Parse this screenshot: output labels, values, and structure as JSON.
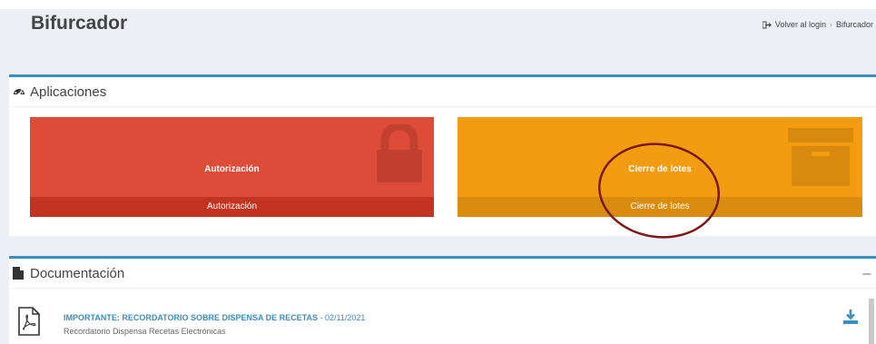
{
  "header": {
    "title": "Bifurcador",
    "breadcrumb": {
      "login_link": "Volver al login",
      "separator": "›",
      "current": "Bifurcador"
    }
  },
  "applications": {
    "title": "Aplicaciones",
    "icon": "dashboard-icon",
    "tiles": [
      {
        "title": "Autorización",
        "footer": "Autorización",
        "color": "#dd4b39",
        "icon": "lock-icon"
      },
      {
        "title": "Cierre de lotes",
        "footer": "Cierre de lotes",
        "color": "#f39c12",
        "icon": "archive-icon"
      }
    ]
  },
  "documentation": {
    "title": "Documentación",
    "icon": "file-icon",
    "collapse_label": "–",
    "items": [
      {
        "title": "IMPORTANTE: RECORDATORIO SOBRE DISPENSA DE RECETAS",
        "date": " - 02/11/2021",
        "subtitle": "Recordatorio Dispensa Recetas Electrónicas",
        "icon": "pdf-icon",
        "action_icon": "download-icon"
      }
    ]
  },
  "colors": {
    "accent": "#3c8dbc",
    "annotation": "#7a1a1a"
  }
}
